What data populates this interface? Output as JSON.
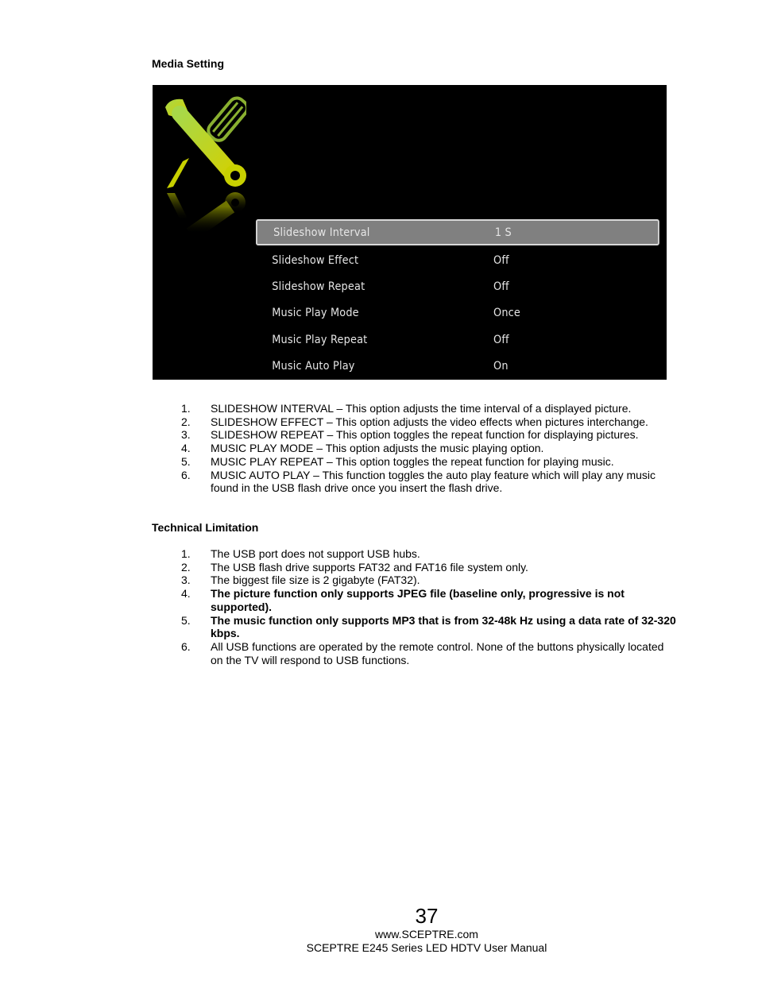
{
  "sections": {
    "media_setting_title": "Media Setting",
    "technical_limitation_title": "Technical Limitation"
  },
  "tv_menu": {
    "icon": "tools-wrench-screwdriver-icon",
    "accent_color": "#c8d400",
    "selected_index": 0,
    "items": [
      {
        "label": "Slideshow Interval",
        "value": "1 S"
      },
      {
        "label": "Slideshow Effect",
        "value": "Off"
      },
      {
        "label": "Slideshow Repeat",
        "value": "Off"
      },
      {
        "label": "Music Play Mode",
        "value": "Once"
      },
      {
        "label": "Music Play Repeat",
        "value": "Off"
      },
      {
        "label": "Music Auto Play",
        "value": "On"
      }
    ]
  },
  "media_list": [
    {
      "num": "1.",
      "text": "SLIDESHOW INTERVAL – This option adjusts the time interval of a displayed picture."
    },
    {
      "num": "2.",
      "text": "SLIDESHOW EFFECT – This option adjusts the video effects when pictures interchange."
    },
    {
      "num": "3.",
      "text": "SLIDESHOW REPEAT – This option toggles the repeat function for displaying pictures."
    },
    {
      "num": "4.",
      "text": "MUSIC PLAY MODE – This option adjusts the music playing option."
    },
    {
      "num": "5.",
      "text": "MUSIC PLAY REPEAT – This option toggles the repeat function for playing music."
    },
    {
      "num": "6.",
      "text": "MUSIC AUTO PLAY – This function toggles the auto play feature which will play any music found in the USB flash drive once you insert the flash drive."
    }
  ],
  "tech_list": [
    {
      "num": "1.",
      "text": "The USB port does not support USB hubs."
    },
    {
      "num": "2.",
      "text": "The USB flash drive supports FAT32 and FAT16 file system only."
    },
    {
      "num": "3.",
      "text": "The biggest file size is 2 gigabyte (FAT32)."
    },
    {
      "num": "4.",
      "text": "The picture function only supports JPEG file (baseline only, progressive is not supported)."
    },
    {
      "num": "5.",
      "text": "The music function only supports MP3 that is from 32-48k Hz using a data rate of 32-320 kbps."
    },
    {
      "num": "6.",
      "text": "All USB functions are operated by the remote control.  None of the buttons physically located on the TV will respond to USB functions."
    }
  ],
  "footer": {
    "page_number": "37",
    "url": "www.SCEPTRE.com",
    "manual_title": "SCEPTRE E245 Series LED HDTV User Manual"
  }
}
